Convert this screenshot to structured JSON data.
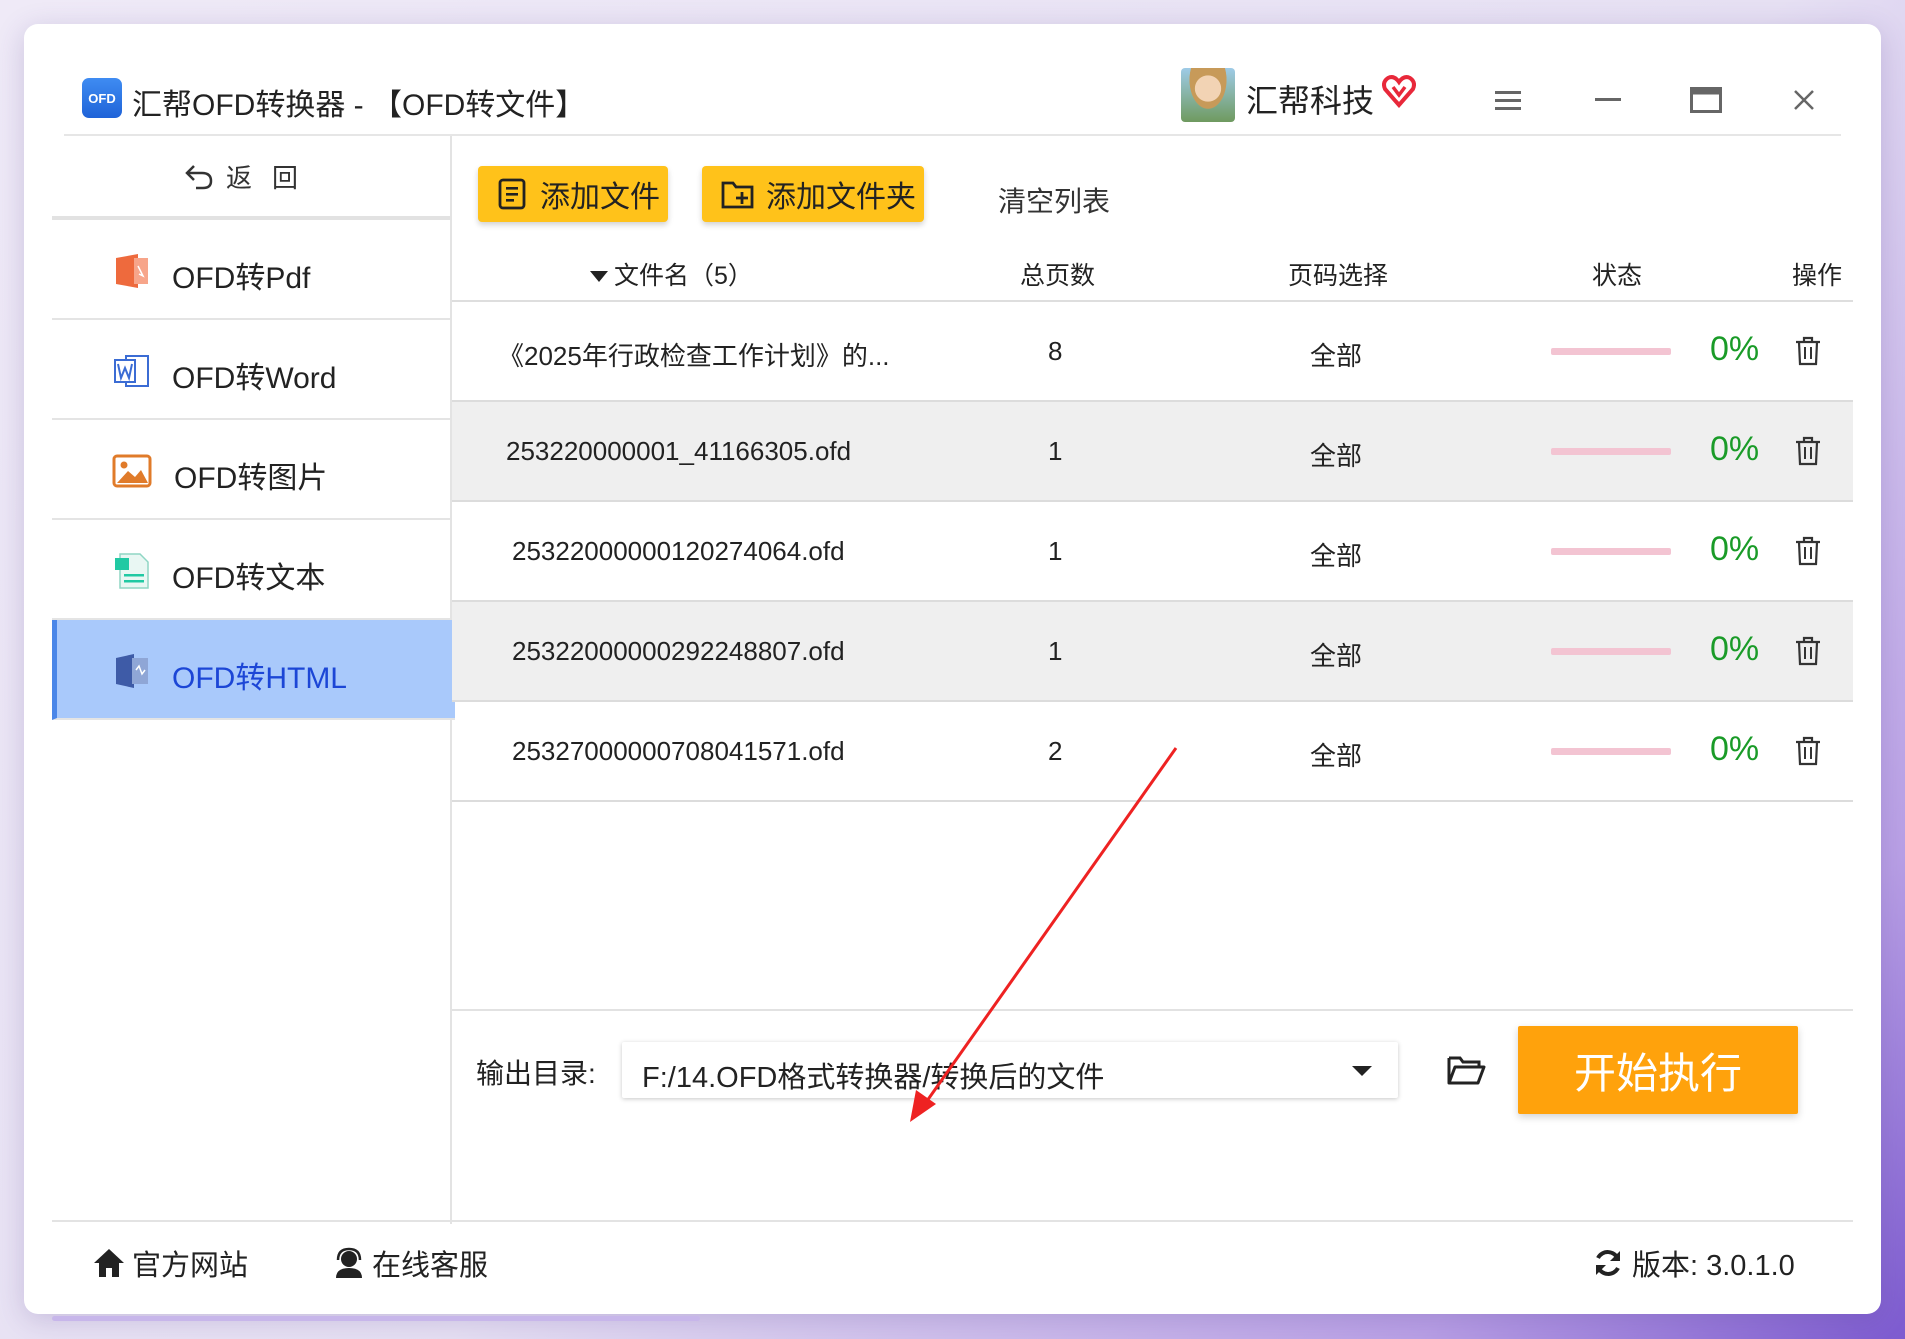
{
  "app": {
    "logo_text": "OFD",
    "title": "汇帮OFD转换器 - 【OFD转文件】",
    "brand": "汇帮科技"
  },
  "sidebar": {
    "back_label": "返回",
    "items": [
      {
        "label": "OFD转Pdf",
        "icon": "pdf-icon",
        "active": false
      },
      {
        "label": "OFD转Word",
        "icon": "word-icon",
        "active": false
      },
      {
        "label": "OFD转图片",
        "icon": "image-icon",
        "active": false
      },
      {
        "label": "OFD转文本",
        "icon": "text-icon",
        "active": false
      },
      {
        "label": "OFD转HTML",
        "icon": "html-icon",
        "active": true
      }
    ]
  },
  "toolbar": {
    "add_file": "添加文件",
    "add_folder": "添加文件夹",
    "clear_list": "清空列表"
  },
  "table": {
    "headers": {
      "filename": "文件名（5）",
      "pages": "总页数",
      "page_select": "页码选择",
      "status": "状态",
      "actions": "操作"
    },
    "rows": [
      {
        "filename": "《2025年行政检查工作计划》的...",
        "pages": "8",
        "page_select": "全部",
        "progress": 0,
        "percent": "0%"
      },
      {
        "filename": "253220000001_41166305.ofd",
        "pages": "1",
        "page_select": "全部",
        "progress": 0,
        "percent": "0%"
      },
      {
        "filename": "25322000000120274064.ofd",
        "pages": "1",
        "page_select": "全部",
        "progress": 0,
        "percent": "0%"
      },
      {
        "filename": "25322000000292248807.ofd",
        "pages": "1",
        "page_select": "全部",
        "progress": 0,
        "percent": "0%"
      },
      {
        "filename": "25327000000708041571.ofd",
        "pages": "2",
        "page_select": "全部",
        "progress": 0,
        "percent": "0%"
      }
    ]
  },
  "output": {
    "label": "输出目录:",
    "path": "F:/14.OFD格式转换器/转换后的文件",
    "start_button": "开始执行"
  },
  "footer": {
    "website": "官方网站",
    "support": "在线客服",
    "version": "版本: 3.0.1.0"
  },
  "colors": {
    "accent_yellow": "#ffc21a",
    "start_orange": "#ffa20c",
    "active_item_bg": "#a9c9fb",
    "percent_green": "#1a9b28",
    "annotation_arrow": "#ee2222"
  }
}
